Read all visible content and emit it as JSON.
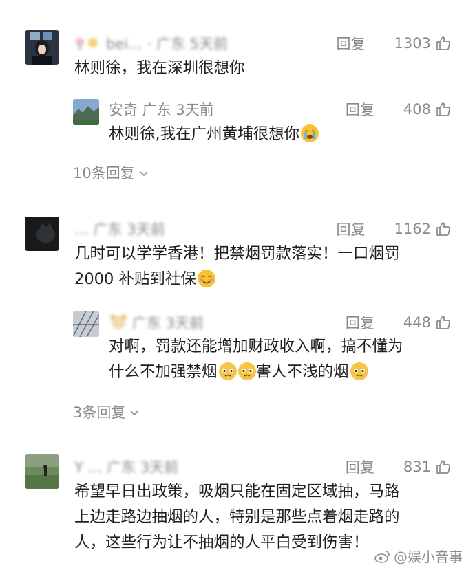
{
  "ui": {
    "reply_label": "回复"
  },
  "comments": [
    {
      "meta": "bei… · 广东 5天前",
      "likes": "1303",
      "text": "林则徐，我在深圳很想你",
      "replies": [
        {
          "meta": "安奇  广东  3天前",
          "likes": "408",
          "text": "林则徐,我在广州黄埔很想你"
        }
      ],
      "more_replies": "10条回复"
    },
    {
      "meta": "… 广东 3天前",
      "likes": "1162",
      "text_lines": [
        "几时可以学学香港！把禁烟罚款落实！一口烟罚",
        "2000 补贴到社保"
      ],
      "replies": [
        {
          "meta": "广东 3天前",
          "likes": "448",
          "text_lines": [
            "对啊，罚款还能增加财政收入啊，搞不懂为",
            "什么不加强禁烟",
            "害人不浅的烟"
          ]
        }
      ],
      "more_replies": "3条回复"
    },
    {
      "meta": "Y … 广东 3天前",
      "likes": "831",
      "text_lines": [
        "希望早日出政策，吸烟只能在固定区域抽，马路",
        "上边走路边抽烟的人，特别是那些点着烟走路的",
        "人，这些行为让不抽烟的人平白受到伤害！"
      ]
    }
  ],
  "watermark": "@娱小音事"
}
